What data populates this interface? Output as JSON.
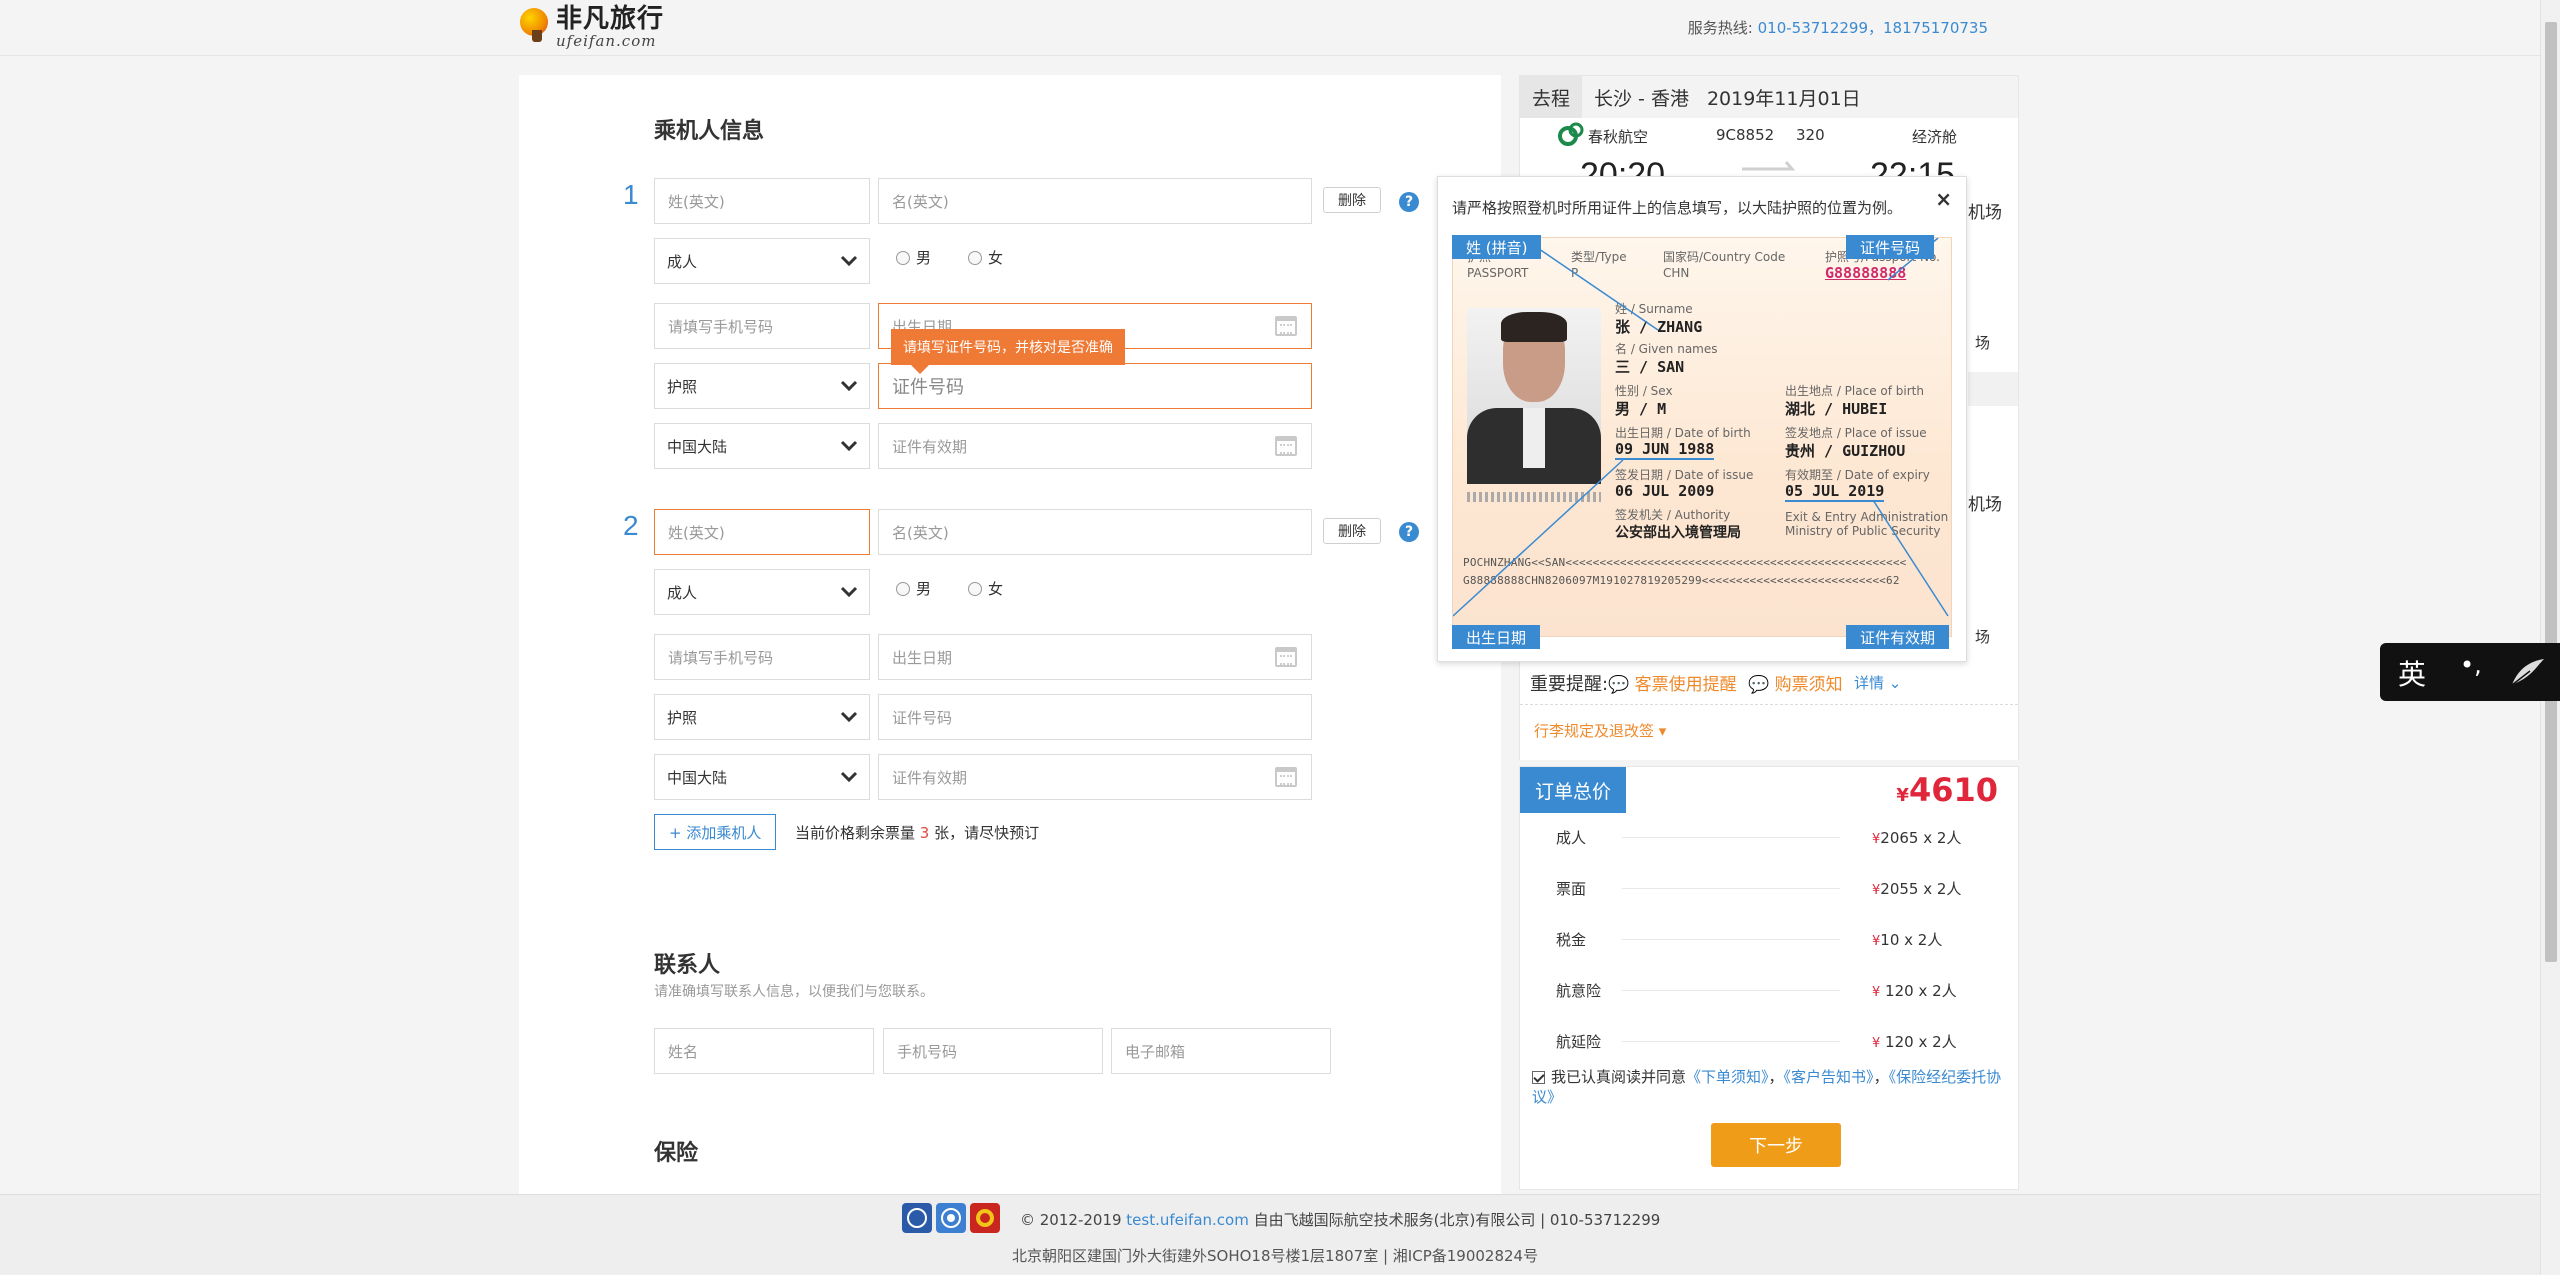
{
  "header": {
    "logo_cn": "非凡旅行",
    "logo_en": "ufeifan.com",
    "hotline_label": "服务热线: ",
    "hotline_numbers": "010-53712299，18175170735"
  },
  "passenger_section": {
    "title": "乘机人信息",
    "passengers": [
      {
        "index": "1",
        "surname_placeholder": "姓(英文)",
        "given_placeholder": "名(英文)",
        "delete_label": "删除",
        "type_value": "成人",
        "gender_male": "男",
        "gender_female": "女",
        "phone_placeholder": "请填写手机号码",
        "birth_placeholder": "出生日期",
        "doc_type_value": "护照",
        "doc_number_placeholder": "证件号码",
        "country_value": "中国大陆",
        "validity_placeholder": "证件有效期"
      },
      {
        "index": "2",
        "surname_placeholder": "姓(英文)",
        "given_placeholder": "名(英文)",
        "delete_label": "删除",
        "type_value": "成人",
        "gender_male": "男",
        "gender_female": "女",
        "phone_placeholder": "请填写手机号码",
        "birth_placeholder": "出生日期",
        "doc_type_value": "护照",
        "doc_number_placeholder": "证件号码",
        "country_value": "中国大陆",
        "validity_placeholder": "证件有效期"
      }
    ],
    "error_tooltip": "请填写证件号码，并核对是否准确",
    "add_button": "+ 添加乘机人",
    "remain_prefix": "当前价格剩余票量 ",
    "remain_count": "3",
    "remain_suffix": " 张，请尽快预订"
  },
  "contact_section": {
    "title": "联系人",
    "note": "请准确填写联系人信息，以便我们与您联系。",
    "name_placeholder": "姓名",
    "phone_placeholder": "手机号码",
    "email_placeholder": "电子邮箱"
  },
  "insurance_section": {
    "title": "保险"
  },
  "flight": {
    "direction_tag": "去程",
    "route": "长沙 - 香港",
    "date": "2019年11月01日",
    "airline": "春秋航空",
    "flight_no": "9C8852",
    "aircraft": "320",
    "cabin": "经济舱",
    "depart_time": "20:20",
    "arrive_time": "22:15",
    "partial_airport": "机场",
    "partial_terminal": "场"
  },
  "notice": {
    "title": "重要提醒:",
    "link1": "客票使用提醒",
    "link2": "购票须知",
    "detail": "详情",
    "luggage": "行李规定及退改签"
  },
  "order": {
    "tag": "订单总价",
    "currency": "¥",
    "total": "4610",
    "lines": [
      {
        "label": "成人",
        "value": "2065 x 2人"
      },
      {
        "label": "票面",
        "value": "2055 x 2人"
      },
      {
        "label": "税金",
        "value": "10 x 2人"
      },
      {
        "label": "航意险",
        "value": " 120 x 2人"
      },
      {
        "label": "航延险",
        "value": " 120 x 2人"
      }
    ],
    "agree_prefix": "我已认真阅读并同意",
    "agree_link1": "《下单须知》",
    "agree_link2": "《客户告知书》",
    "agree_link3": "《保险经纪委托协议》",
    "next_button": "下一步"
  },
  "passport_popup": {
    "tip": "请严格按照登机时所用证件上的信息填写，以大陆护照的位置为例。",
    "close": "×",
    "label_surname": "姓 (拼音)",
    "label_docno": "证件号码",
    "label_birth": "出生日期",
    "label_validity": "证件有效期",
    "hdr_passport": "护照",
    "hdr_passport_en": "PASSPORT",
    "hdr_type": "类型/Type",
    "hdr_type_val": "P",
    "hdr_country": "国家码/Country Code",
    "hdr_country_val": "CHN",
    "hdr_no": "护照号/Passport No.",
    "hdr_no_val": "G88888888",
    "surname_lbl": "姓 / Surname",
    "surname_val": "张 / ZHANG",
    "given_lbl": "名 / Given names",
    "given_val": "三 / SAN",
    "sex_lbl": "性别 / Sex",
    "sex_val": "男 / M",
    "pob_lbl": "出生地点 / Place of birth",
    "pob_val": "湖北 / HUBEI",
    "dob_lbl": "出生日期 / Date of birth",
    "dob_val": "09 JUN 1988",
    "poi_lbl": "签发地点 / Place of issue",
    "poi_val": "贵州 / GUIZHOU",
    "doi_lbl": "签发日期 / Date of issue",
    "doi_val": "06 JUL 2009",
    "doe_lbl": "有效期至 / Date of expiry",
    "doe_val": "05 JUL 2019",
    "auth_lbl": "签发机关 / Authority",
    "auth_val": "公安部出入境管理局",
    "auth_en1": "Exit & Entry Administration",
    "auth_en2": "Ministry of Public Security",
    "mrz1": "POCHNZHANG<<SAN<<<<<<<<<<<<<<<<<<<<<<<<<<<<<<<<<<<<<<<<<<<<<<<<<<",
    "mrz2": "G88888888CHN8206097M191027819205299<<<<<<<<<<<<<<<<<<<<<<<<<<<62"
  },
  "footer": {
    "copyright": "© 2012-2019 ",
    "site": "test.ufeifan.com",
    "company": " 自由飞越国际航空技术服务(北京)有限公司 | 010-53712299",
    "address": "北京朝阳区建国门外大街建外SOHO18号楼1层1807室 | 湘ICP备19002824号"
  },
  "ime": {
    "mode": "英",
    "punct": "•,"
  },
  "colors": {
    "accent": "#3a8ad1",
    "error": "#ef7a36",
    "price": "#e0263b",
    "next_button": "#ef9d19"
  }
}
